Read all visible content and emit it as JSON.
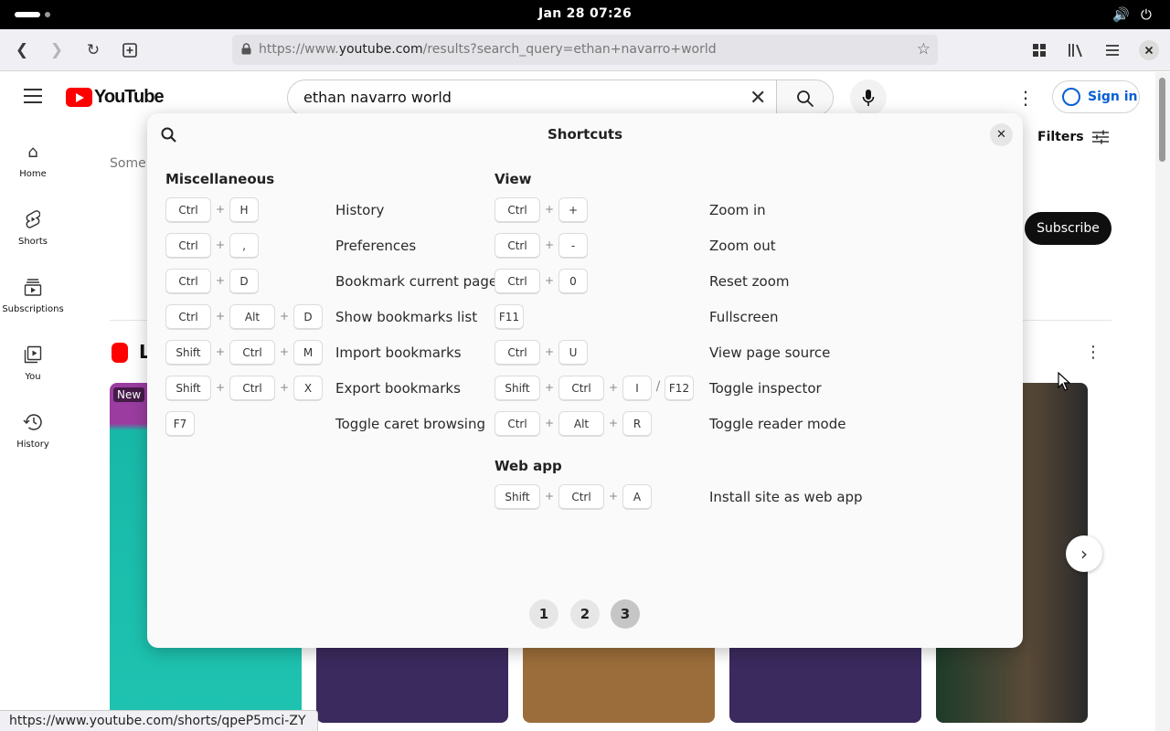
{
  "system": {
    "clock": "Jan 28  07:26"
  },
  "browser": {
    "url_prefix": "https://www.",
    "url_host": "youtube.com",
    "url_path": "/results?search_query=ethan+navarro+world",
    "status_url": "https://www.youtube.com/shorts/qpeP5mci-ZY"
  },
  "youtube": {
    "logo_text": "YouTube",
    "search_value": "ethan navarro world",
    "signin_label": "Sign in",
    "filters_label": "Filters",
    "subscribe_label": "Subscribe",
    "partial_text": "Some r",
    "shelf_title_partial": "L",
    "new_badge": "New",
    "guide": [
      {
        "label": "Home",
        "icon": "home-icon"
      },
      {
        "label": "Shorts",
        "icon": "shorts-icon"
      },
      {
        "label": "Subscriptions",
        "icon": "subscriptions-icon"
      },
      {
        "label": "You",
        "icon": "you-icon"
      },
      {
        "label": "History",
        "icon": "history-icon"
      }
    ]
  },
  "shortcuts": {
    "title": "Shortcuts",
    "sections": {
      "misc": {
        "heading": "Miscellaneous",
        "rows": [
          {
            "keys": [
              "Ctrl",
              "H"
            ],
            "desc": "History"
          },
          {
            "keys": [
              "Ctrl",
              ","
            ],
            "desc": "Preferences"
          },
          {
            "keys": [
              "Ctrl",
              "D"
            ],
            "desc": "Bookmark current page"
          },
          {
            "keys": [
              "Ctrl",
              "Alt",
              "D"
            ],
            "desc": "Show bookmarks list"
          },
          {
            "keys": [
              "Shift",
              "Ctrl",
              "M"
            ],
            "desc": "Import bookmarks"
          },
          {
            "keys": [
              "Shift",
              "Ctrl",
              "X"
            ],
            "desc": "Export bookmarks"
          },
          {
            "keys": [
              "F7"
            ],
            "desc": "Toggle caret browsing"
          }
        ]
      },
      "view": {
        "heading": "View",
        "rows": [
          {
            "keys": [
              "Ctrl",
              "+"
            ],
            "desc": "Zoom in"
          },
          {
            "keys": [
              "Ctrl",
              "-"
            ],
            "desc": "Zoom out"
          },
          {
            "keys": [
              "Ctrl",
              "0"
            ],
            "desc": "Reset zoom"
          },
          {
            "keys": [
              "F11"
            ],
            "desc": "Fullscreen"
          },
          {
            "keys": [
              "Ctrl",
              "U"
            ],
            "desc": "View page source"
          },
          {
            "keys": [
              "Shift",
              "Ctrl",
              "I"
            ],
            "alt_key": "F12",
            "alt_sep": "/",
            "desc": "Toggle inspector"
          },
          {
            "keys": [
              "Ctrl",
              "Alt",
              "R"
            ],
            "desc": "Toggle reader mode"
          }
        ]
      },
      "webapp": {
        "heading": "Web app",
        "rows": [
          {
            "keys": [
              "Shift",
              "Ctrl",
              "A"
            ],
            "desc": "Install site as web app"
          }
        ]
      }
    },
    "pages": [
      "1",
      "2",
      "3"
    ],
    "current_page": "3"
  }
}
